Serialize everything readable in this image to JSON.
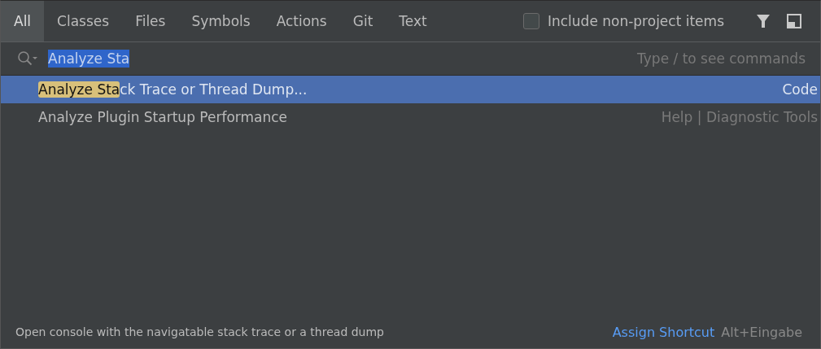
{
  "tabs": [
    {
      "label": "All",
      "selected": true
    },
    {
      "label": "Classes",
      "selected": false
    },
    {
      "label": "Files",
      "selected": false
    },
    {
      "label": "Symbols",
      "selected": false
    },
    {
      "label": "Actions",
      "selected": false
    },
    {
      "label": "Git",
      "selected": false
    },
    {
      "label": "Text",
      "selected": false
    }
  ],
  "include_non_project": {
    "label": "Include non-project items",
    "checked": false
  },
  "search": {
    "value": "Analyze Sta",
    "placeholder": "Type / to see commands"
  },
  "results": [
    {
      "match": "Analyze Sta",
      "rest": "ck Trace or Thread Dump...",
      "location": "Code",
      "selected": true
    },
    {
      "rest": "Analyze Plugin Startup Performance",
      "location": "Help | Diagnostic Tools",
      "selected": false
    }
  ],
  "status_bar": {
    "description": "Open console with the navigatable stack trace or a thread dump",
    "link": "Assign Shortcut",
    "shortcut": "Alt+Eingabe"
  }
}
